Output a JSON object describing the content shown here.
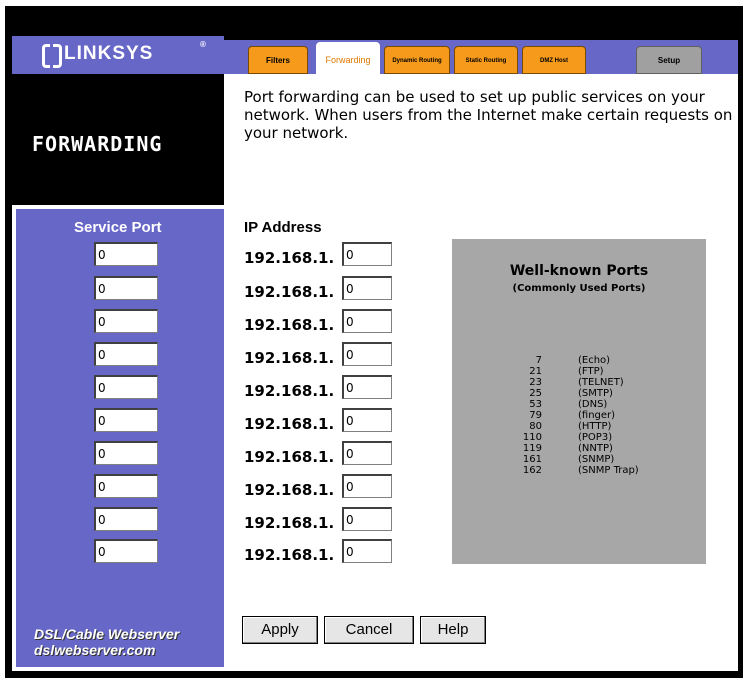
{
  "brand": {
    "logo_text": "LINKSYS",
    "logo_reg": "®"
  },
  "tabs": [
    {
      "label": "Filters",
      "active": false
    },
    {
      "label": "Forwarding",
      "active": true
    },
    {
      "label": "Dynamic Routing",
      "active": false
    },
    {
      "label": "Static Routing",
      "active": false
    },
    {
      "label": "DMZ Host",
      "active": false
    },
    {
      "label": "Setup",
      "active": false
    }
  ],
  "page": {
    "title": "FORWARDING",
    "description": "Port forwarding can be used to set up public services on your network. When users from the Internet make certain requests on your network."
  },
  "table": {
    "service_port_header": "Service Port",
    "ip_header": "IP Address",
    "ip_prefix": "192.168.1.",
    "rows": [
      {
        "port": "0",
        "ip": "0"
      },
      {
        "port": "0",
        "ip": "0"
      },
      {
        "port": "0",
        "ip": "0"
      },
      {
        "port": "0",
        "ip": "0"
      },
      {
        "port": "0",
        "ip": "0"
      },
      {
        "port": "0",
        "ip": "0"
      },
      {
        "port": "0",
        "ip": "0"
      },
      {
        "port": "0",
        "ip": "0"
      },
      {
        "port": "0",
        "ip": "0"
      },
      {
        "port": "0",
        "ip": "0"
      }
    ]
  },
  "ports_box": {
    "title": "Well-known Ports",
    "subtitle": "(Commonly Used Ports)",
    "ports": [
      {
        "num": "7",
        "name": "(Echo)"
      },
      {
        "num": "21",
        "name": "(FTP)"
      },
      {
        "num": "23",
        "name": "(TELNET)"
      },
      {
        "num": "25",
        "name": "(SMTP)"
      },
      {
        "num": "53",
        "name": "(DNS)"
      },
      {
        "num": "79",
        "name": "(finger)"
      },
      {
        "num": "80",
        "name": "(HTTP)"
      },
      {
        "num": "110",
        "name": "(POP3)"
      },
      {
        "num": "119",
        "name": "(NNTP)"
      },
      {
        "num": "161",
        "name": "(SNMP)"
      },
      {
        "num": "162",
        "name": "(SNMP Trap)"
      }
    ]
  },
  "buttons": {
    "apply": "Apply",
    "cancel": "Cancel",
    "help": "Help"
  },
  "footer": {
    "line1": "DSL/Cable Webserver",
    "line2": "dslwebserver.com"
  },
  "colors": {
    "accent": "#6767c8",
    "tab": "#f59a1b",
    "ports_bg": "#a7a7a7"
  }
}
